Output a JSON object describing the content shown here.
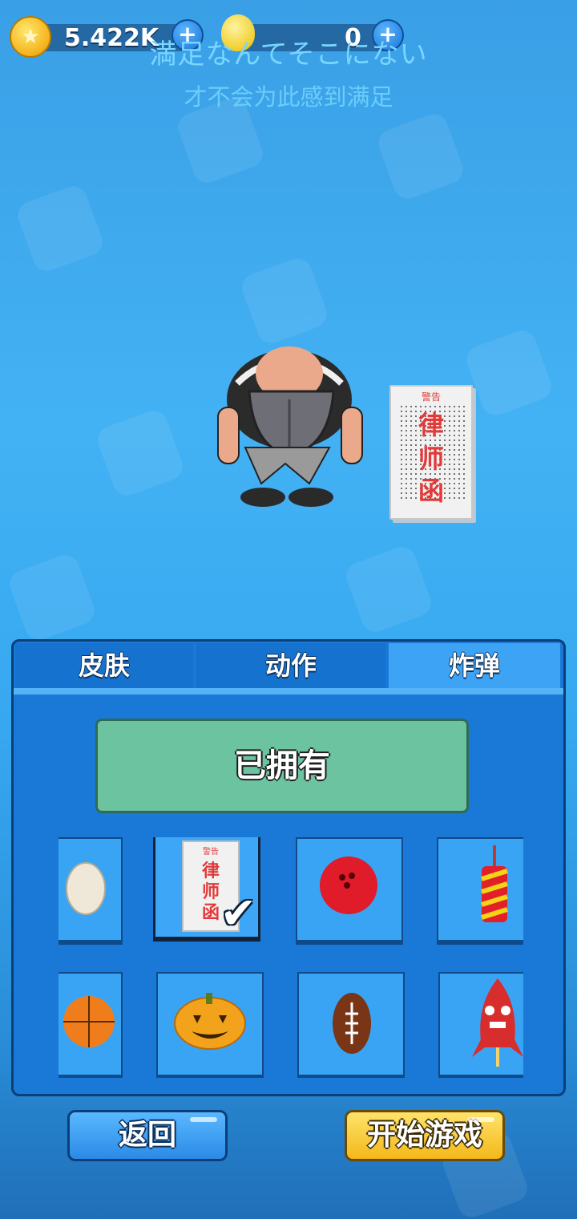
{
  "header": {
    "coins_value": "5.422K",
    "bulbs_value": "0",
    "title_jp": "満足なんてそこにない",
    "title_cn": "才不会为此感到满足"
  },
  "preview": {
    "letter_warning": "警告",
    "letter_text": [
      "律",
      "师",
      "函"
    ]
  },
  "tabs": [
    {
      "label": "皮肤",
      "active": false
    },
    {
      "label": "动作",
      "active": false
    },
    {
      "label": "炸弹",
      "active": true
    }
  ],
  "status_label": "已拥有",
  "items": [
    {
      "name": "egg",
      "selected": false
    },
    {
      "name": "lawyer-letter",
      "selected": true
    },
    {
      "name": "bowling-ball",
      "selected": false
    },
    {
      "name": "firecracker",
      "selected": false
    },
    {
      "name": "basketball",
      "selected": false
    },
    {
      "name": "pumpkin",
      "selected": false
    },
    {
      "name": "football",
      "selected": false
    },
    {
      "name": "angry-rocket",
      "selected": false
    }
  ],
  "buttons": {
    "back": "返回",
    "start": "开始游戏"
  },
  "colors": {
    "accent_blue": "#1a79d6",
    "owned_green": "#6cc3a0",
    "start_yellow": "#f3b81a"
  }
}
